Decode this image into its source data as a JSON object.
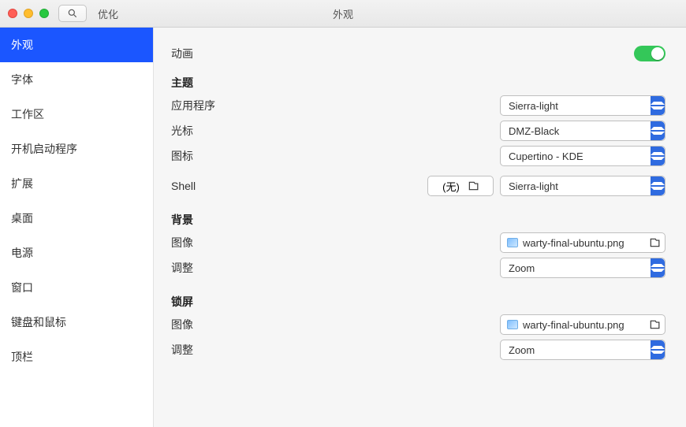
{
  "titlebar": {
    "app_name": "优化",
    "window_title": "外观"
  },
  "sidebar": {
    "items": [
      {
        "label": "外观",
        "selected": true
      },
      {
        "label": "字体"
      },
      {
        "label": "工作区"
      },
      {
        "label": "开机启动程序"
      },
      {
        "label": "扩展"
      },
      {
        "label": "桌面"
      },
      {
        "label": "电源"
      },
      {
        "label": "窗口"
      },
      {
        "label": "键盘和鼠标"
      },
      {
        "label": "顶栏"
      }
    ]
  },
  "content": {
    "animation": {
      "label": "动画",
      "enabled": true
    },
    "theme": {
      "heading": "主题",
      "application": {
        "label": "应用程序",
        "value": "Sierra-light"
      },
      "cursor": {
        "label": "光标",
        "value": "DMZ-Black"
      },
      "icons": {
        "label": "图标",
        "value": "Cupertino - KDE"
      },
      "shell": {
        "label": "Shell",
        "none_label": "(无)",
        "value": "Sierra-light"
      }
    },
    "background": {
      "heading": "背景",
      "image": {
        "label": "图像",
        "value": "warty-final-ubuntu.png"
      },
      "adjust": {
        "label": "调整",
        "value": "Zoom"
      }
    },
    "lockscreen": {
      "heading": "锁屏",
      "image": {
        "label": "图像",
        "value": "warty-final-ubuntu.png"
      },
      "adjust": {
        "label": "调整",
        "value": "Zoom"
      }
    }
  }
}
